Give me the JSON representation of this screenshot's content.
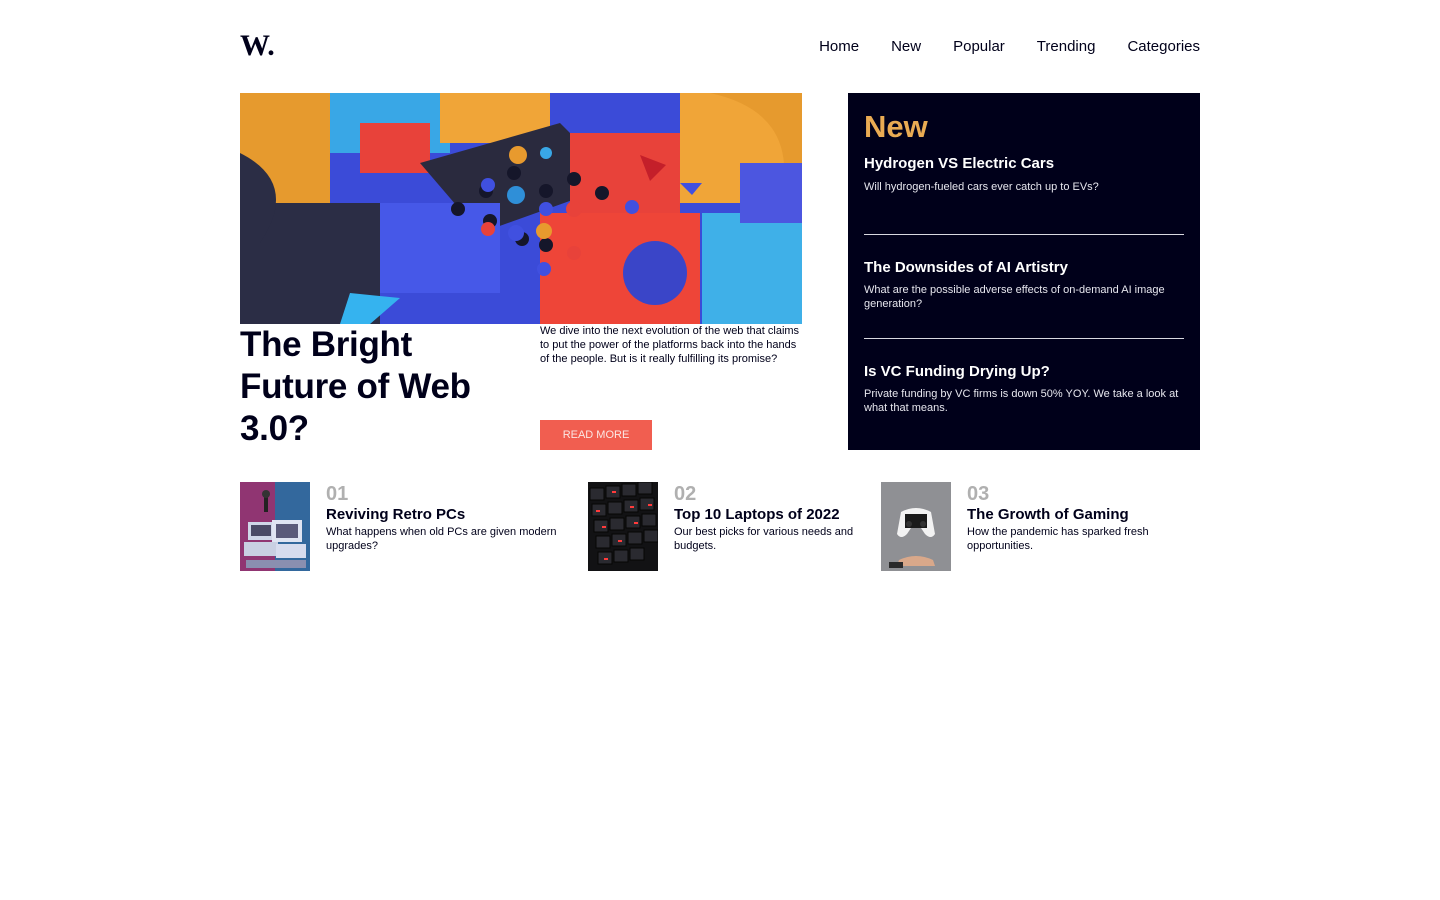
{
  "header": {
    "logo_text": "W.",
    "nav": [
      "Home",
      "New",
      "Popular",
      "Trending",
      "Categories"
    ]
  },
  "hero": {
    "image_icon": "abstract-3d-blocks-image",
    "title": "The Bright Future of Web 3.0?",
    "description": "We dive into the next evolution of the web that claims to put the power of the platforms back into the hands of the people. But is it really fulfilling its promise?",
    "button_label": "READ MORE"
  },
  "new_panel": {
    "heading": "New",
    "items": [
      {
        "title": "Hydrogen VS Electric Cars",
        "summary": "Will hydrogen-fueled cars ever catch up to EVs?"
      },
      {
        "title": "The Downsides of AI Artistry",
        "summary": "What are the possible adverse effects of on-demand AI image generation?"
      },
      {
        "title": "Is VC Funding Drying Up?",
        "summary": "Private funding by VC firms is down 50% YOY. We take a look at what that means."
      }
    ]
  },
  "articles": [
    {
      "number": "01",
      "title": "Reviving Retro PCs",
      "summary": "What happens when old PCs are given modern upgrades?",
      "image_icon": "retro-pc-image"
    },
    {
      "number": "02",
      "title": "Top 10 Laptops of 2022",
      "summary": "Our best picks for various needs and budgets.",
      "image_icon": "keyboard-image"
    },
    {
      "number": "03",
      "title": "The Growth of Gaming",
      "summary": "How the pandemic has sparked fresh opportunities.",
      "image_icon": "game-controller-image"
    }
  ],
  "colors": {
    "navy": "#00001a",
    "accent_orange": "#e9ab53",
    "button_red": "#f15e50",
    "muted_number": "#b0b0b0"
  }
}
